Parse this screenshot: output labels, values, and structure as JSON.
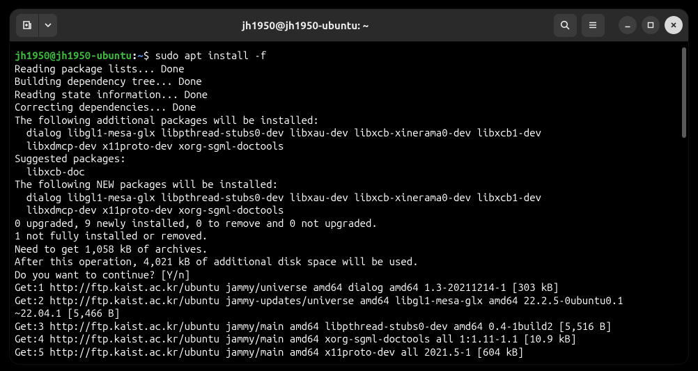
{
  "window": {
    "title": "jh1950@jh1950-ubuntu: ~"
  },
  "icons": {
    "new_tab": "new-tab-icon",
    "chevron": "chevron-down-icon",
    "search": "search-icon",
    "menu": "hamburger-icon",
    "minimize": "minimize-icon",
    "maximize": "maximize-icon",
    "close": "close-icon"
  },
  "prompt": {
    "user_host": "jh1950@jh1950-ubuntu",
    "colon": ":",
    "path": "~",
    "dollar": "$ ",
    "command": "sudo apt install -f"
  },
  "output": [
    "Reading package lists... Done",
    "Building dependency tree... Done",
    "Reading state information... Done",
    "Correcting dependencies... Done",
    "The following additional packages will be installed:",
    "  dialog libgl1-mesa-glx libpthread-stubs0-dev libxau-dev libxcb-xinerama0-dev libxcb1-dev",
    "  libxdmcp-dev x11proto-dev xorg-sgml-doctools",
    "Suggested packages:",
    "  libxcb-doc",
    "The following NEW packages will be installed:",
    "  dialog libgl1-mesa-glx libpthread-stubs0-dev libxau-dev libxcb-xinerama0-dev libxcb1-dev",
    "  libxdmcp-dev x11proto-dev xorg-sgml-doctools",
    "0 upgraded, 9 newly installed, 0 to remove and 0 not upgraded.",
    "1 not fully installed or removed.",
    "Need to get 1,058 kB of archives.",
    "After this operation, 4,021 kB of additional disk space will be used.",
    "Do you want to continue? [Y/n]",
    "Get:1 http://ftp.kaist.ac.kr/ubuntu jammy/universe amd64 dialog amd64 1.3-20211214-1 [303 kB]",
    "Get:2 http://ftp.kaist.ac.kr/ubuntu jammy-updates/universe amd64 libgl1-mesa-glx amd64 22.2.5-0ubuntu0.1",
    "~22.04.1 [5,466 B]",
    "Get:3 http://ftp.kaist.ac.kr/ubuntu jammy/main amd64 libpthread-stubs0-dev amd64 0.4-1build2 [5,516 B]",
    "Get:4 http://ftp.kaist.ac.kr/ubuntu jammy/main amd64 xorg-sgml-doctools all 1:1.11-1.1 [10.9 kB]",
    "Get:5 http://ftp.kaist.ac.kr/ubuntu jammy/main amd64 x11proto-dev all 2021.5-1 [604 kB]"
  ]
}
